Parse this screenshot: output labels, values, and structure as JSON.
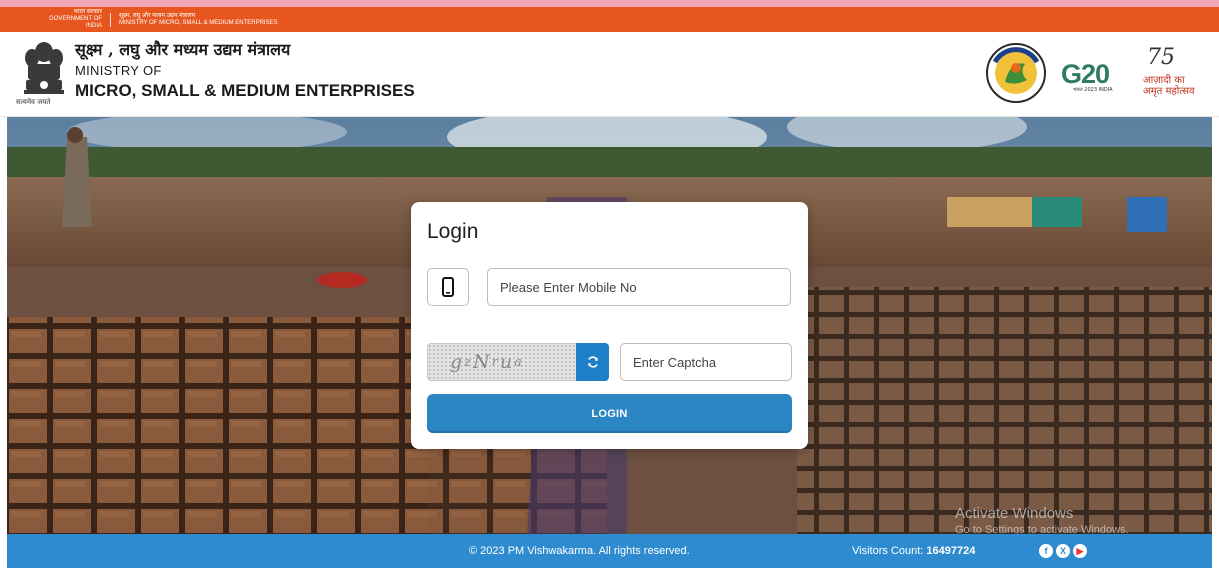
{
  "gov_bar": {
    "hindi_left": "भारत सरकार",
    "english_left": "GOVERNMENT OF INDIA",
    "hindi_right": "सूक्ष्म, लघु और मध्यम उद्यम मंत्रालय",
    "english_right": "MINISTRY OF MICRO, SMALL & MEDIUM ENTERPRISES"
  },
  "header": {
    "ministry_hindi": "सूक्ष्म , लघु और मध्यम उद्यम मंत्रालय",
    "ministry_of": "MINISTRY OF",
    "ministry_english": "MICRO, SMALL & MEDIUM ENTERPRISES",
    "emblem_caption": "सत्यमेव जयते",
    "logos": {
      "g20_text": "G20",
      "g20_small": "भारत 2023 INDIA",
      "azadi_num": "75",
      "azadi_text": "आज़ादी का अमृत महोत्सव"
    }
  },
  "login": {
    "title": "Login",
    "mobile_placeholder": "Please Enter Mobile No",
    "captcha_chars": [
      "g",
      "z",
      "N",
      "r",
      "u",
      "a"
    ],
    "captcha_placeholder": "Enter Captcha",
    "button_label": "LOGIN"
  },
  "footer": {
    "copyright": "© 2023 PM Vishwakarma. All rights reserved.",
    "visitors_label": "Visitors Count:",
    "visitors_count": "16497724",
    "social_icons": [
      "facebook-icon",
      "x-icon",
      "youtube-icon"
    ]
  },
  "watermark": {
    "line1": "Activate Windows",
    "line2": "Go to Settings to activate Windows."
  },
  "colors": {
    "gov_bar": "#e8561f",
    "primary_blue": "#2d86c4",
    "footer_blue": "#2f8bd0"
  }
}
